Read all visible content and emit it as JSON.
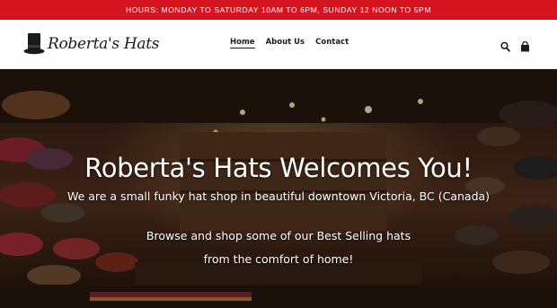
{
  "announcement": {
    "text": "HOURS: MONDAY TO SATURDAY 10AM TO 6PM, SUNDAY 12 NOON TO 5PM"
  },
  "header": {
    "logo_text": "Roberta's Hats",
    "nav": [
      {
        "label": "Home",
        "active": true
      },
      {
        "label": "About Us",
        "active": false
      },
      {
        "label": "Contact",
        "active": false
      }
    ],
    "icons": [
      "search-icon",
      "cart-icon"
    ]
  },
  "hero": {
    "title": "Roberta's Hats Welcomes You!",
    "line1": "We are a small funky hat shop in beautiful downtown Victoria, BC (Canada)",
    "line2": "Browse and shop some of our Best Selling hats",
    "line3": "from the comfort of home!"
  },
  "colors": {
    "announcement_bg": "#d6141f",
    "header_bg": "#ffffff",
    "text_dark": "#1c1c1c"
  }
}
